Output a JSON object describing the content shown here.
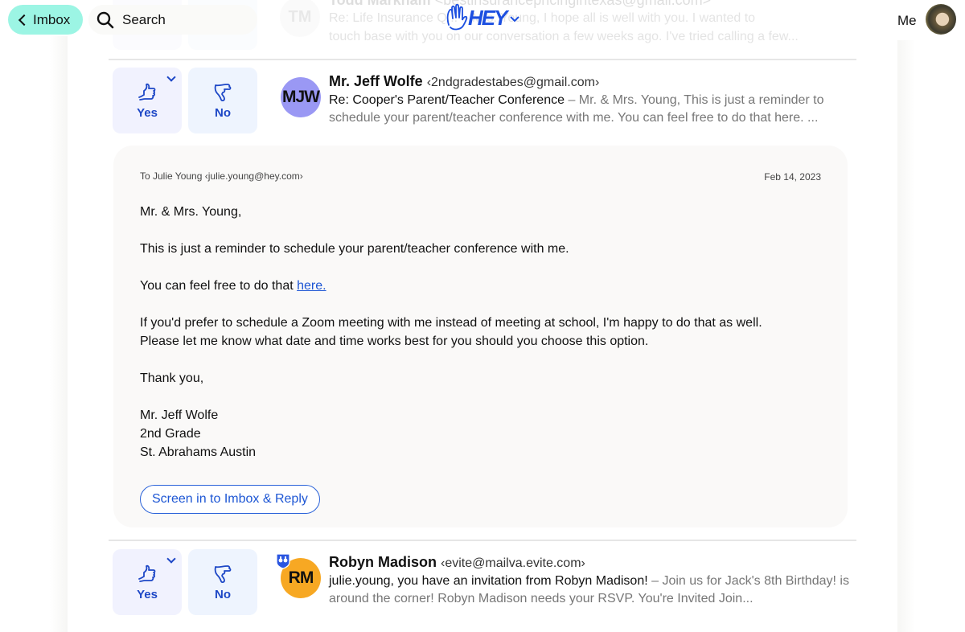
{
  "top_bar": {
    "back_label": "Imbox",
    "search_label": "Search",
    "logo_text": "HEY",
    "me_label": "Me"
  },
  "colors": {
    "accent": "#1d47c6",
    "back_button_bg": "#9cf5e4",
    "mjw_avatar": "#9a98f4",
    "rm_avatar": "#f7a823",
    "link": "#1d56d4"
  },
  "emails": [
    {
      "initials": "TM",
      "sender_name": "Todd Markham",
      "sender_email": "<bestinsurancepricingintexas@gmail.com>",
      "subject": "Re: Life Insurance Q...",
      "snippet_line1": "Re: Life Insurance Q... – Mrs. Young, I hope all is well with you. I wanted to",
      "snippet_line2": "touch base with you on our conversation a few weeks ago. I've tried calling a few...",
      "faded": true
    },
    {
      "initials": "MJW",
      "sender_name": "Mr. Jeff Wolfe",
      "sender_email": "‹2ndgradestabes@gmail.com›",
      "subject": "Re: Cooper's Parent/Teacher Conference",
      "snippet": " – Mr. & Mrs. Young, This is just a reminder to schedule your parent/teacher conference with me. You can feel free to do that here. ...",
      "yes_label": "Yes",
      "no_label": "No",
      "expanded": {
        "to_line": "To Julie Young ‹julie.young@hey.com›",
        "date": "Feb 14, 2023",
        "greeting": "Mr. & Mrs. Young,",
        "para1": "This is just a reminder to schedule your parent/teacher conference with me.",
        "para2_prefix": "You can feel free to do that ",
        "para2_link": "here.",
        "para3_line1": "If you'd prefer to schedule a Zoom meeting with me instead of meeting at school, I'm happy to do that as well.",
        "para3_line2": "Please let me know what date and time works best for you should you choose this option.",
        "closing": "Thank you,",
        "sig_name": "Mr. Jeff Wolfe",
        "sig_title": "2nd Grade",
        "sig_school": "St. Abrahams Austin",
        "reply_button": "Screen in to Imbox & Reply"
      }
    },
    {
      "initials": "RM",
      "sender_name": "Robyn Madison",
      "sender_email": "‹evite@mailva.evite.com›",
      "subject": "julie.young, you have an invitation from Robyn Madison!",
      "snippet": " – Join us for Jack's 8th Birthday! is around the corner! Robyn Madison needs your RSVP. You're Invited Join...",
      "yes_label": "Yes",
      "no_label": "No",
      "badge_icon": "binoculars-shield-icon"
    }
  ]
}
